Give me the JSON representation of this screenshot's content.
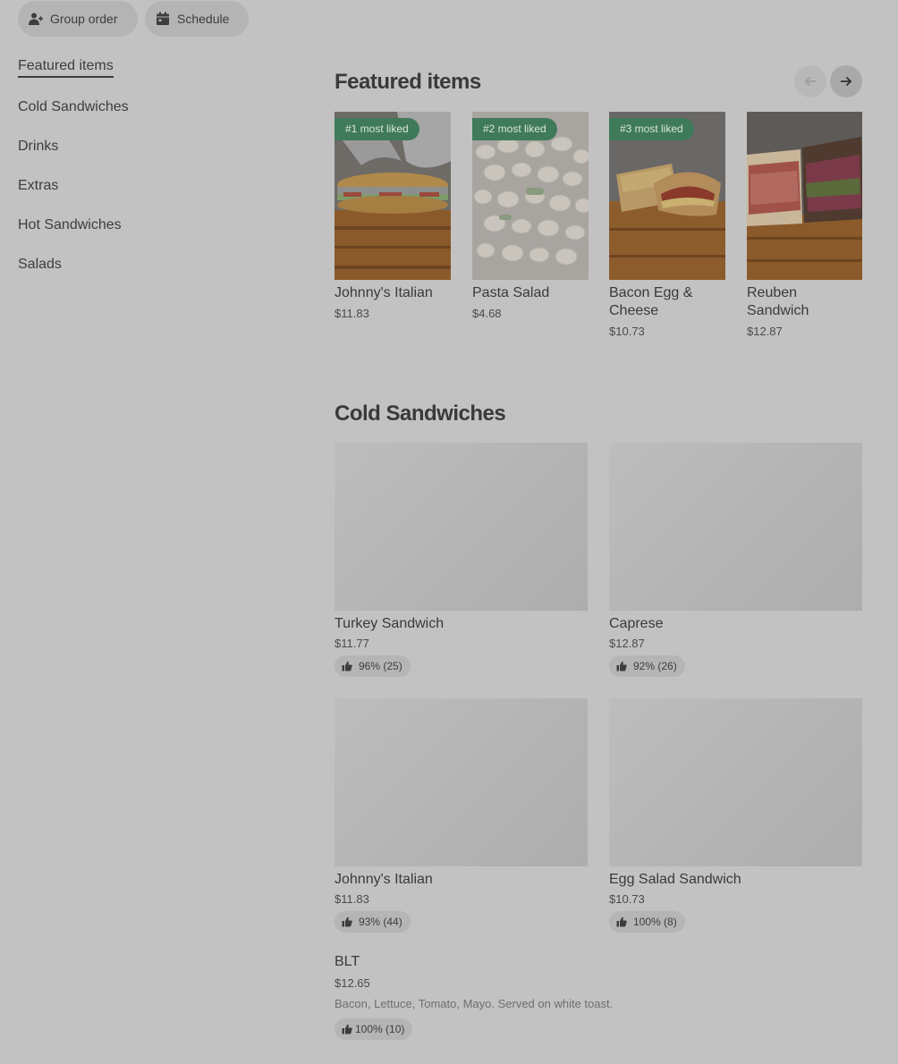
{
  "top_actions": {
    "group_order": "Group order",
    "schedule": "Schedule"
  },
  "sidebar": {
    "items": [
      {
        "label": "Featured items",
        "active": true
      },
      {
        "label": "Cold Sandwiches"
      },
      {
        "label": "Drinks"
      },
      {
        "label": "Extras"
      },
      {
        "label": "Hot Sandwiches"
      },
      {
        "label": "Salads"
      }
    ]
  },
  "featured": {
    "title": "Featured items",
    "items": [
      {
        "badge": "#1 most liked",
        "name": "Johnny's Italian",
        "price": "$11.83",
        "image": "sub-sandwich-photo"
      },
      {
        "badge": "#2 most liked",
        "name": "Pasta Salad",
        "price": "$4.68",
        "image": "pasta-salad-photo"
      },
      {
        "badge": "#3 most liked",
        "name": "Bacon Egg & Cheese",
        "price": "$10.73",
        "image": "breakfast-sandwich-photo"
      },
      {
        "name": "Reuben Sandwich",
        "price": "$12.87",
        "image": "reuben-sandwich-photo"
      }
    ]
  },
  "cold_sandwiches": {
    "title": "Cold Sandwiches",
    "items": [
      {
        "name": "Turkey Sandwich",
        "price": "$11.77",
        "rating": "96% (25)"
      },
      {
        "name": "Caprese",
        "price": "$12.87",
        "rating": "92% (26)"
      },
      {
        "name": "Johnny's Italian",
        "price": "$11.83",
        "rating": "93% (44)"
      },
      {
        "name": "Egg Salad Sandwich",
        "price": "$10.73",
        "rating": "100% (8)"
      }
    ],
    "blt": {
      "name": "BLT",
      "price": "$12.65",
      "description": "Bacon, Lettuce, Tomato, Mayo. Served on white toast.",
      "rating": "100% (10)"
    }
  },
  "colors": {
    "background": "#c2c2c2",
    "badge": "#3f7a5a",
    "pill": "#b4b4b4"
  }
}
